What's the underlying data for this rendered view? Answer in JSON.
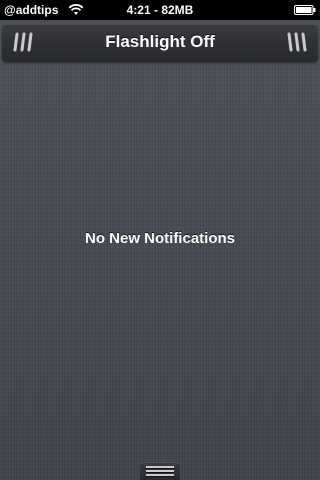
{
  "status_bar": {
    "carrier": "@addtips",
    "time_memory": "4:21 - 82MB",
    "wifi_icon": "wifi-icon",
    "battery_icon": "battery-icon",
    "battery_level": 1.0
  },
  "widget": {
    "title": "Flashlight Off",
    "left_icon": "grip-icon",
    "right_icon": "grip-icon"
  },
  "notifications": {
    "empty_message": "No New Notifications"
  },
  "handle": {
    "icon": "pull-handle-icon"
  },
  "colors": {
    "background": "#474a52",
    "status_bar": "#000000",
    "widget_bar": "#2f3135",
    "text": "#ffffff"
  }
}
